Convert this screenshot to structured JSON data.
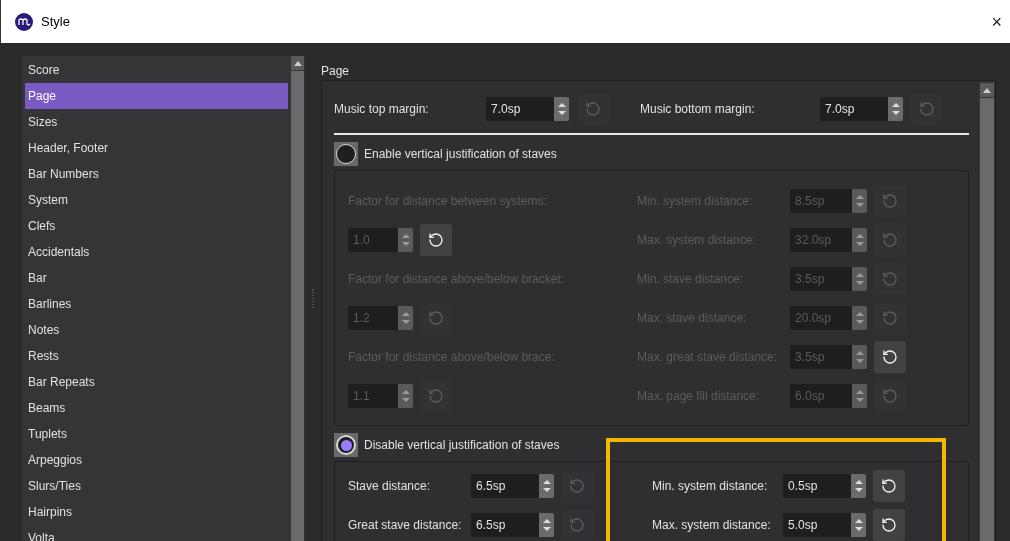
{
  "window": {
    "title": "Style",
    "close": "×"
  },
  "sidebar": {
    "items": [
      {
        "label": "Score",
        "selected": false
      },
      {
        "label": "Page",
        "selected": true
      },
      {
        "label": "Sizes",
        "selected": false
      },
      {
        "label": "Header, Footer",
        "selected": false
      },
      {
        "label": "Bar Numbers",
        "selected": false
      },
      {
        "label": "System",
        "selected": false
      },
      {
        "label": "Clefs",
        "selected": false
      },
      {
        "label": "Accidentals",
        "selected": false
      },
      {
        "label": "Bar",
        "selected": false
      },
      {
        "label": "Barlines",
        "selected": false
      },
      {
        "label": "Notes",
        "selected": false
      },
      {
        "label": "Rests",
        "selected": false
      },
      {
        "label": "Bar Repeats",
        "selected": false
      },
      {
        "label": "Beams",
        "selected": false
      },
      {
        "label": "Tuplets",
        "selected": false
      },
      {
        "label": "Arpeggios",
        "selected": false
      },
      {
        "label": "Slurs/Ties",
        "selected": false
      },
      {
        "label": "Hairpins",
        "selected": false
      },
      {
        "label": "Volta",
        "selected": false
      }
    ]
  },
  "page": {
    "title": "Page",
    "margins": [
      {
        "label": "Music top margin:",
        "value": "7.0sp",
        "reset_enabled": false
      },
      {
        "label": "Music bottom margin:",
        "value": "7.0sp",
        "reset_enabled": false
      }
    ],
    "justification": [
      {
        "label": "Enable vertical justification of staves",
        "selected": false,
        "left": [
          {
            "kind": "caption",
            "label": "Factor for distance between systems:"
          },
          {
            "kind": "spin",
            "value": "1.0",
            "reset_enabled": true
          },
          {
            "kind": "caption",
            "label": "Factor for distance above/below bracket:"
          },
          {
            "kind": "spin",
            "value": "1.2",
            "reset_enabled": false
          },
          {
            "kind": "caption",
            "label": "Factor for distance above/below brace:"
          },
          {
            "kind": "spin",
            "value": "1.1",
            "reset_enabled": false
          }
        ],
        "right": [
          {
            "label": "Min. system distance:",
            "value": "8.5sp",
            "reset_enabled": false
          },
          {
            "label": "Max. system distance:",
            "value": "32.0sp",
            "reset_enabled": false
          },
          {
            "label": "Min. stave distance:",
            "value": "3.5sp",
            "reset_enabled": false
          },
          {
            "label": "Max. stave distance:",
            "value": "20.0sp",
            "reset_enabled": false
          },
          {
            "label": "Max. great stave distance:",
            "value": "3.5sp",
            "reset_enabled": true
          },
          {
            "label": "Max. page fill distance:",
            "value": "6.0sp",
            "reset_enabled": false
          }
        ]
      },
      {
        "label": "Disable vertical justification of staves",
        "selected": true,
        "left": [
          {
            "kind": "field",
            "label": "Stave distance:",
            "value": "6.5sp",
            "reset_enabled": false
          },
          {
            "kind": "field",
            "label": "Great stave distance:",
            "value": "6.5sp",
            "reset_enabled": false
          }
        ],
        "right": [
          {
            "label": "Min. system distance:",
            "value": "0.5sp",
            "reset_enabled": true
          },
          {
            "label": "Max. system distance:",
            "value": "5.0sp",
            "reset_enabled": true
          }
        ]
      }
    ]
  }
}
